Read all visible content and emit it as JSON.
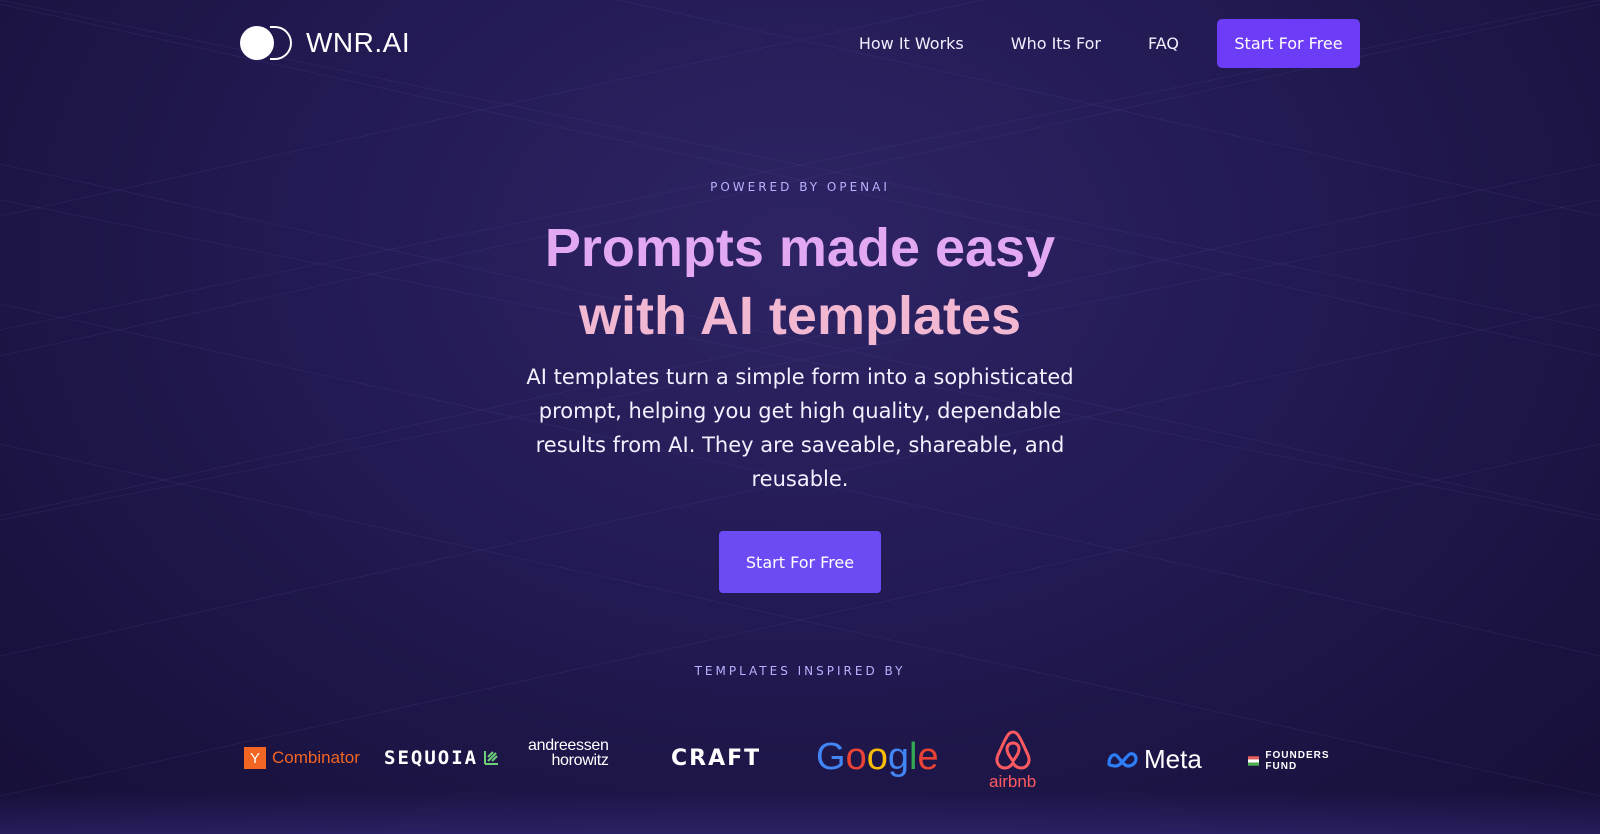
{
  "header": {
    "logo_text": "WNR.AI",
    "nav": [
      {
        "label": "How It Works"
      },
      {
        "label": "Who Its For"
      },
      {
        "label": "FAQ"
      }
    ],
    "cta_label": "Start For Free"
  },
  "hero": {
    "eyebrow": "POWERED BY OPENAI",
    "headline_line1": "Prompts made easy",
    "headline_line2": "with AI templates",
    "subtext": "AI templates turn a simple form into a sophisticated prompt, helping you get high quality, dependable results from AI. They are saveable, shareable, and reusable.",
    "cta_label": "Start For Free"
  },
  "inspired": {
    "label": "TEMPLATES INSPIRED BY",
    "brands": {
      "ycombinator": {
        "mark": "Y",
        "text": "Combinator"
      },
      "sequoia": {
        "text": "SEQUOIA"
      },
      "a16z": {
        "line1": "andreessen",
        "line2": "horowitz"
      },
      "craft": {
        "text": "CRAFT"
      },
      "google": {
        "letters": [
          "G",
          "o",
          "o",
          "g",
          "l",
          "e"
        ]
      },
      "airbnb": {
        "text": "airbnb"
      },
      "meta": {
        "text": "Meta"
      },
      "founders_fund": {
        "text": "FOUNDERS FUND"
      }
    }
  },
  "colors": {
    "accent": "#6c3cf6",
    "headline_pink": "#e3a8f2",
    "yc_orange": "#f26522",
    "airbnb_red": "#ff5a5f"
  }
}
